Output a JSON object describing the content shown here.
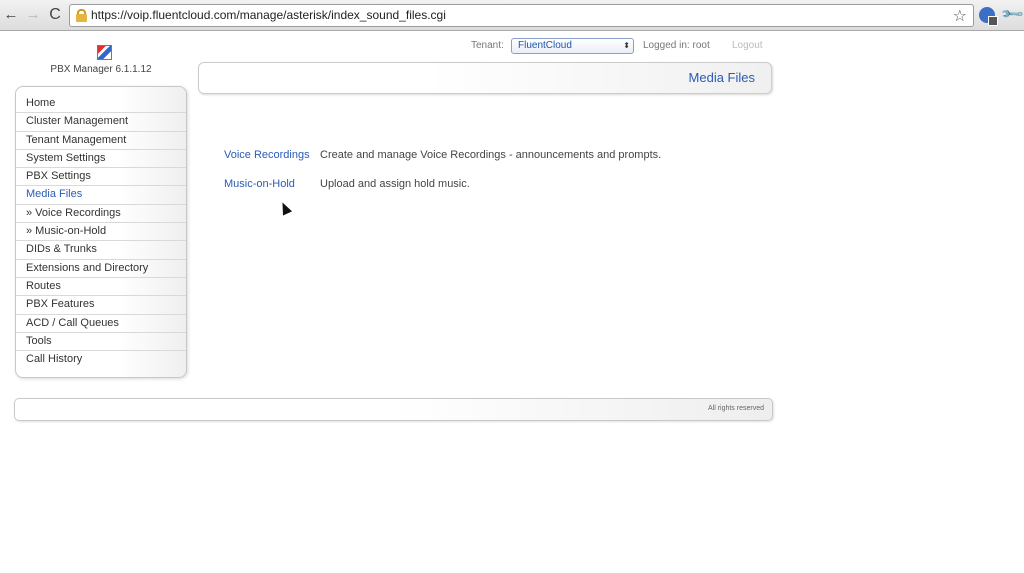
{
  "browser": {
    "url": "https://voip.fluentcloud.com/manage/asterisk/index_sound_files.cgi",
    "back_icon": "←",
    "forward_icon": "→",
    "reload_icon": "C",
    "star_icon": "☆",
    "wrench_icon": "🔧"
  },
  "header": {
    "app_version": "PBX Manager 6.1.1.12",
    "tenant_label": "Tenant:",
    "tenant_value": "FluentCloud",
    "logged_in": "Logged in: root",
    "logout": "Logout"
  },
  "page": {
    "title": "Media Files"
  },
  "sidebar": {
    "items": [
      {
        "label": "Home"
      },
      {
        "label": "Cluster Management"
      },
      {
        "label": "Tenant Management"
      },
      {
        "label": "System Settings"
      },
      {
        "label": "PBX Settings"
      },
      {
        "label": "Media Files",
        "active": true
      },
      {
        "label": "» Voice Recordings"
      },
      {
        "label": "» Music-on-Hold"
      },
      {
        "label": "DIDs & Trunks"
      },
      {
        "label": "Extensions and Directory"
      },
      {
        "label": "Routes"
      },
      {
        "label": "PBX Features"
      },
      {
        "label": "ACD / Call Queues"
      },
      {
        "label": "Tools"
      },
      {
        "label": "Call History"
      }
    ]
  },
  "content": {
    "rows": [
      {
        "link": "Voice Recordings",
        "description": "Create and manage Voice Recordings - announcements and prompts."
      },
      {
        "link": "Music-on-Hold",
        "description": "Upload and assign hold music."
      }
    ]
  },
  "footer": {
    "text": "All rights reserved"
  },
  "colors": {
    "link": "#2a5bb5",
    "text": "#333333"
  }
}
